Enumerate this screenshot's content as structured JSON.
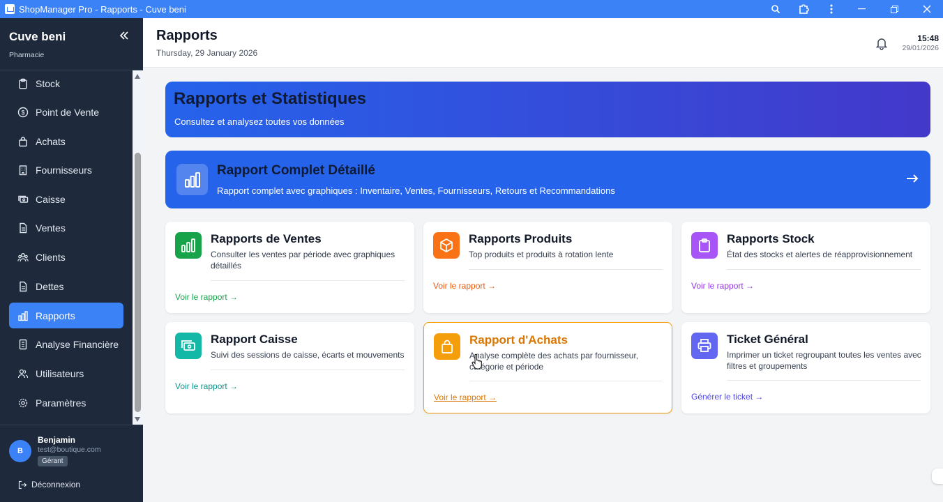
{
  "window": {
    "title": "ShopManager Pro - Rapports - Cuve beni"
  },
  "sidebar": {
    "store_name": "Cuve beni",
    "store_type": "Pharmacie",
    "items": [
      {
        "label": "Stock",
        "icon": "clipboard-icon"
      },
      {
        "label": "Point de Vente",
        "icon": "dollar-circle-icon"
      },
      {
        "label": "Achats",
        "icon": "shopping-bag-icon"
      },
      {
        "label": "Fournisseurs",
        "icon": "building-icon"
      },
      {
        "label": "Caisse",
        "icon": "cash-icon"
      },
      {
        "label": "Ventes",
        "icon": "document-icon"
      },
      {
        "label": "Clients",
        "icon": "users-icon"
      },
      {
        "label": "Dettes",
        "icon": "document-icon"
      },
      {
        "label": "Rapports",
        "icon": "chart-icon",
        "active": true
      },
      {
        "label": "Analyse Financière",
        "icon": "document-icon"
      },
      {
        "label": "Utilisateurs",
        "icon": "user-group-icon"
      },
      {
        "label": "Paramètres",
        "icon": "gear-icon"
      }
    ],
    "user": {
      "initial": "B",
      "name": "Benjamin",
      "email": "test@boutique.com",
      "role": "Gérant"
    },
    "logout_label": "Déconnexion"
  },
  "header": {
    "title": "Rapports",
    "date": "Thursday, 29 January 2026",
    "time": "15:48",
    "short_date": "29/01/2026"
  },
  "hero": {
    "title": "Rapports et Statistiques",
    "subtitle": "Consultez et analysez toutes vos données"
  },
  "full_report": {
    "title": "Rapport Complet Détaillé",
    "subtitle": "Rapport complet avec graphiques : Inventaire, Ventes, Fournisseurs, Retours et Recommandations",
    "arrow": "→"
  },
  "cards": [
    {
      "title": "Rapports de Ventes",
      "desc": "Consulter les ventes par période avec graphiques détaillés",
      "link": "Voir le rapport →",
      "color": "#16a34a"
    },
    {
      "title": "Rapports Produits",
      "desc": "Top produits et produits à rotation lente",
      "link": "Voir le rapport →",
      "color": "#ea580c"
    },
    {
      "title": "Rapports Stock",
      "desc": "État des stocks et alertes de réapprovisionnement",
      "link": "Voir le rapport →",
      "color": "#9333ea"
    },
    {
      "title": "Rapport Caisse",
      "desc": "Suivi des sessions de caisse, écarts et mouvements",
      "link": "Voir le rapport →",
      "color": "#0d9488"
    },
    {
      "title": "Rapport d'Achats",
      "desc": "Analyse complète des achats par fournisseur, catégorie et période",
      "link": "Voir le rapport →",
      "color": "#d97706"
    },
    {
      "title": "Ticket Général",
      "desc": "Imprimer un ticket regroupant toutes les ventes avec filtres et groupements",
      "link": "Générer le ticket →",
      "color": "#4f46e5"
    }
  ]
}
